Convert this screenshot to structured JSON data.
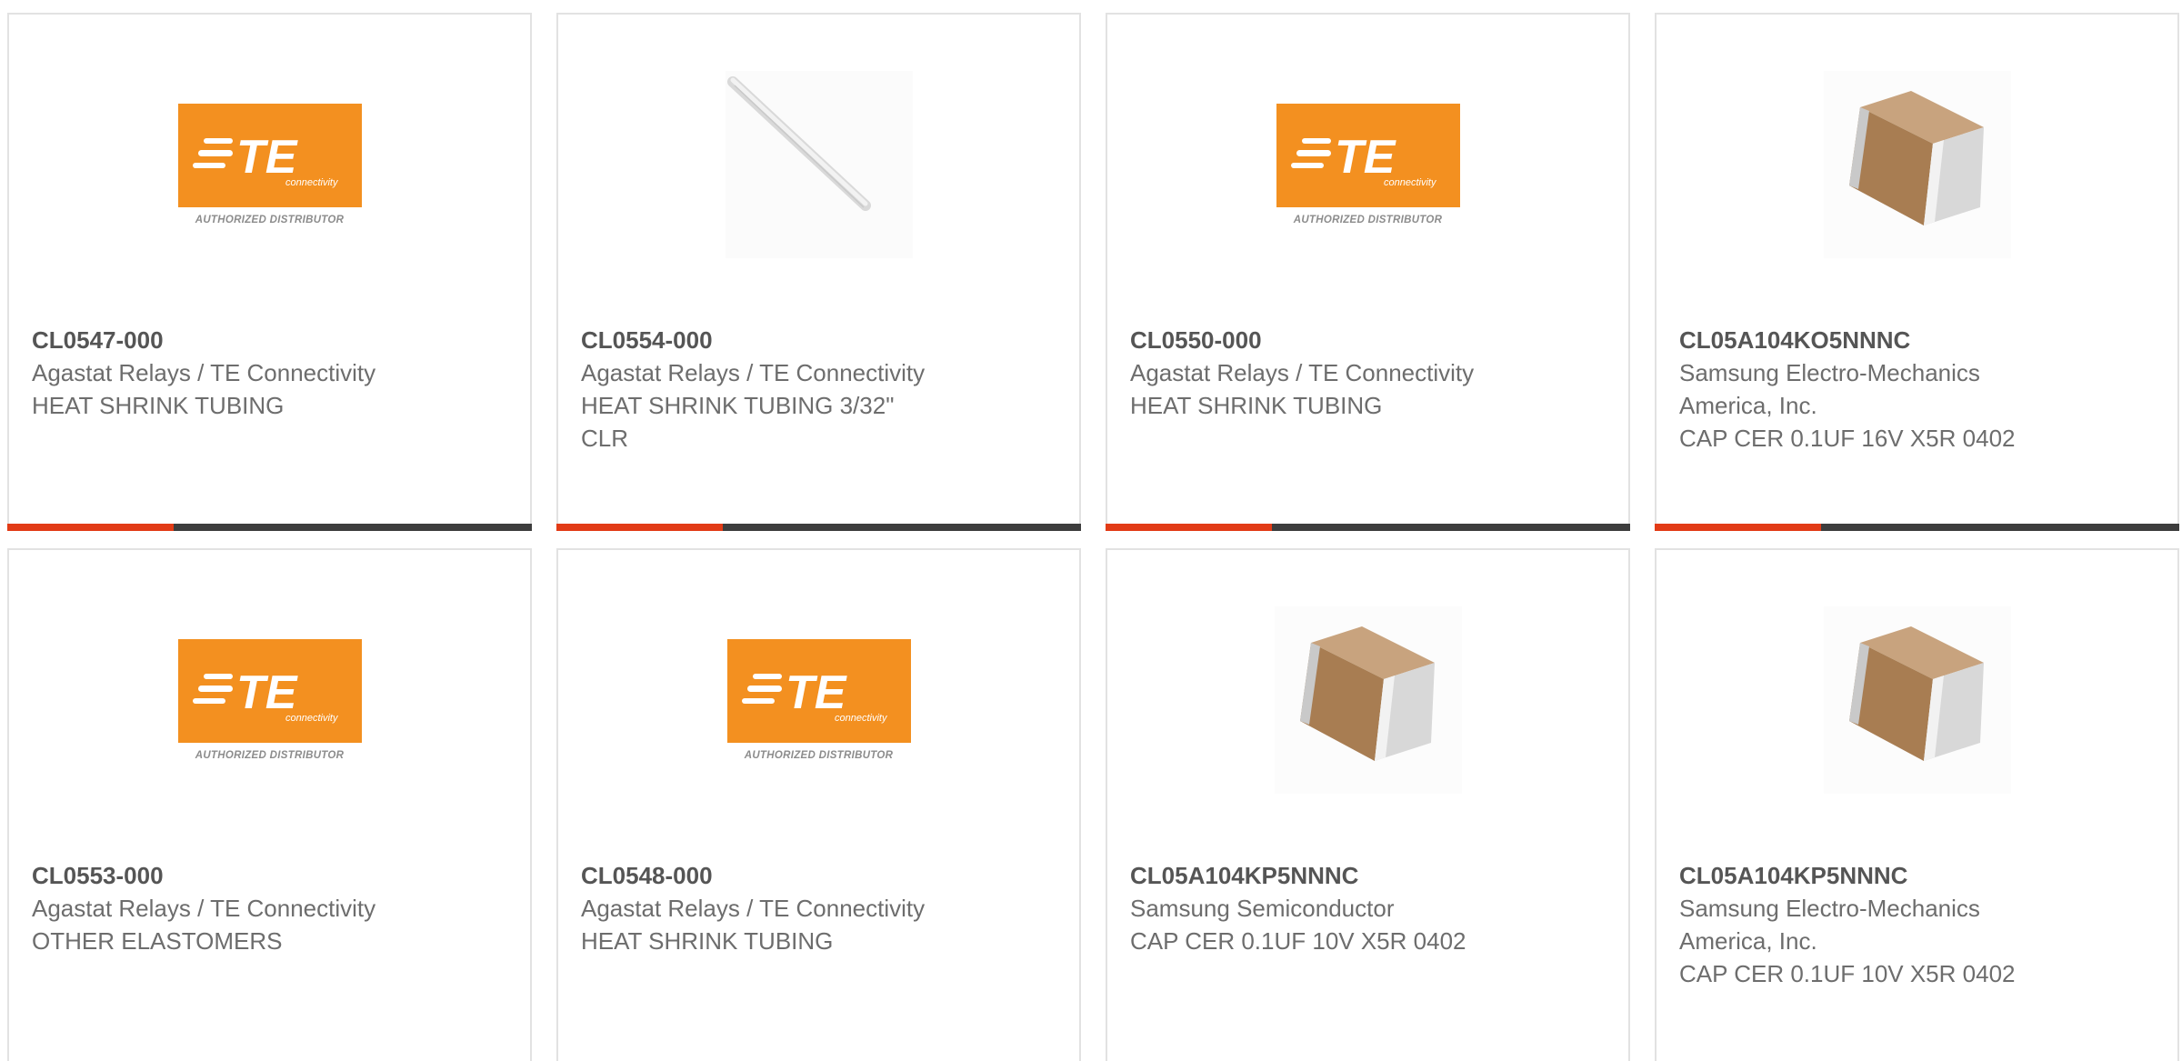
{
  "logo_text": {
    "brand": "TE",
    "sub": "connectivity",
    "caption": "AUTHORIZED DISTRIBUTOR"
  },
  "colors": {
    "accent": "#e23b16",
    "bar": "#3d3d3d",
    "te_orange": "#f39020"
  },
  "products": [
    {
      "part_number": "CL0547-000",
      "manufacturer": [
        "Agastat Relays / TE Connectivity"
      ],
      "description": [
        "HEAT SHRINK TUBING"
      ],
      "image": "te-authorized-distributor-logo"
    },
    {
      "part_number": "CL0554-000",
      "manufacturer": [
        "Agastat Relays / TE Connectivity"
      ],
      "description": [
        "HEAT SHRINK TUBING 3/32\"",
        "CLR"
      ],
      "image": "heat-shrink-tube-image"
    },
    {
      "part_number": "CL0550-000",
      "manufacturer": [
        "Agastat Relays / TE Connectivity"
      ],
      "description": [
        "HEAT SHRINK TUBING"
      ],
      "image": "te-authorized-distributor-logo"
    },
    {
      "part_number": "CL05A104KO5NNNC",
      "manufacturer": [
        "Samsung Electro-Mechanics",
        "America, Inc."
      ],
      "description": [
        "CAP CER 0.1UF 16V X5R 0402"
      ],
      "image": "ceramic-capacitor-image"
    },
    {
      "part_number": "CL0553-000",
      "manufacturer": [
        "Agastat Relays / TE Connectivity"
      ],
      "description": [
        "OTHER ELASTOMERS"
      ],
      "image": "te-authorized-distributor-logo"
    },
    {
      "part_number": "CL0548-000",
      "manufacturer": [
        "Agastat Relays / TE Connectivity"
      ],
      "description": [
        "HEAT SHRINK TUBING"
      ],
      "image": "te-authorized-distributor-logo"
    },
    {
      "part_number": "CL05A104KP5NNNC",
      "manufacturer": [
        "Samsung Semiconductor"
      ],
      "description": [
        "CAP CER 0.1UF 10V X5R 0402"
      ],
      "image": "ceramic-capacitor-image"
    },
    {
      "part_number": "CL05A104KP5NNNC",
      "manufacturer": [
        "Samsung Electro-Mechanics",
        "America, Inc."
      ],
      "description": [
        "CAP CER 0.1UF 10V X5R 0402"
      ],
      "image": "ceramic-capacitor-image"
    }
  ]
}
